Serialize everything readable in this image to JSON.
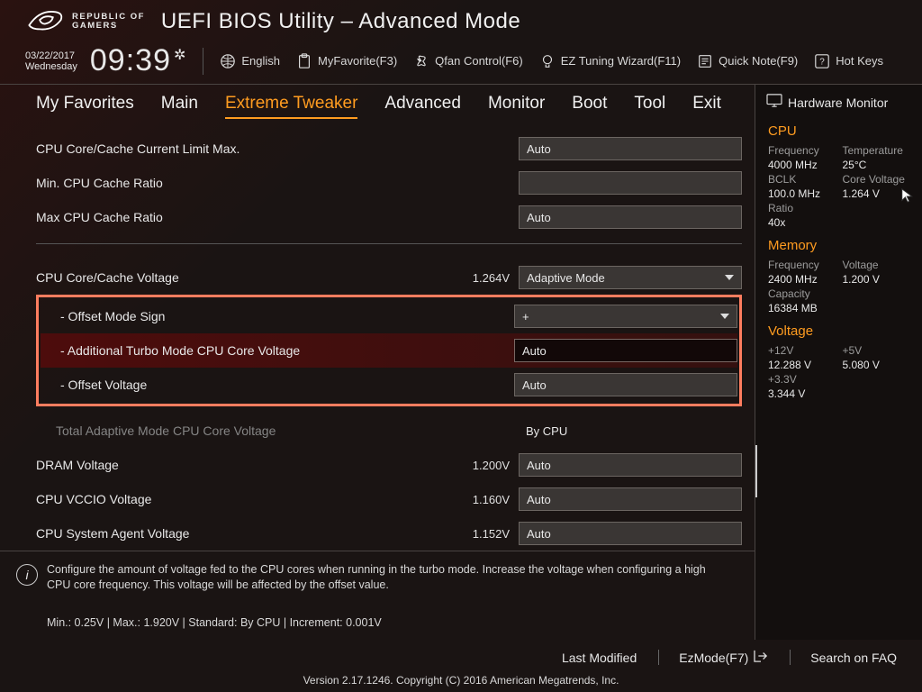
{
  "brand": {
    "line1": "REPUBLIC OF",
    "line2": "GAMERS"
  },
  "title": "UEFI BIOS Utility – Advanced Mode",
  "date": {
    "d": "03/22/2017",
    "w": "Wednesday"
  },
  "clock": "09:39",
  "toolbar": {
    "language": "English",
    "favorite": "MyFavorite(F3)",
    "qfan": "Qfan Control(F6)",
    "eztune": "EZ Tuning Wizard(F11)",
    "quicknote": "Quick Note(F9)",
    "hotkeys": "Hot Keys"
  },
  "tabs": [
    "My Favorites",
    "Main",
    "Extreme Tweaker",
    "Advanced",
    "Monitor",
    "Boot",
    "Tool",
    "Exit"
  ],
  "active_tab": 2,
  "hw_title": "Hardware Monitor",
  "settings": {
    "cpu_core_cache_limit": {
      "label": "CPU Core/Cache Current Limit Max.",
      "value": "Auto"
    },
    "min_cache_ratio": {
      "label": "Min. CPU Cache Ratio",
      "value": ""
    },
    "max_cache_ratio": {
      "label": "Max CPU Cache Ratio",
      "value": "Auto"
    },
    "cpu_core_cache_voltage": {
      "label": "CPU Core/Cache Voltage",
      "suffix": "1.264V",
      "value": "Adaptive Mode"
    },
    "offset_mode_sign": {
      "label": "- Offset Mode Sign",
      "value": "+"
    },
    "add_turbo_core_voltage": {
      "label": "- Additional Turbo Mode CPU Core Voltage",
      "value": "Auto"
    },
    "offset_voltage": {
      "label": "- Offset Voltage",
      "value": "Auto"
    },
    "total_adaptive": {
      "label": "Total Adaptive Mode CPU Core Voltage",
      "value": "By CPU"
    },
    "dram_voltage": {
      "label": "DRAM Voltage",
      "suffix": "1.200V",
      "value": "Auto"
    },
    "cpu_vccio": {
      "label": "CPU VCCIO Voltage",
      "suffix": "1.160V",
      "value": "Auto"
    },
    "cpu_sa": {
      "label": "CPU System Agent Voltage",
      "suffix": "1.152V",
      "value": "Auto"
    }
  },
  "help": {
    "text": "Configure the amount of voltage fed to the CPU cores when running in the turbo mode. Increase the voltage when configuring a high CPU core frequency. This voltage will be affected by the offset value.",
    "footer": "Min.: 0.25V   |   Max.: 1.920V   |   Standard: By CPU   |   Increment: 0.001V"
  },
  "hw": {
    "cpu": {
      "title": "CPU",
      "freq_l": "Frequency",
      "freq_v": "4000 MHz",
      "temp_l": "Temperature",
      "temp_v": "25°C",
      "bclk_l": "BCLK",
      "bclk_v": "100.0 MHz",
      "cv_l": "Core Voltage",
      "cv_v": "1.264 V",
      "ratio_l": "Ratio",
      "ratio_v": "40x"
    },
    "mem": {
      "title": "Memory",
      "freq_l": "Frequency",
      "freq_v": "2400 MHz",
      "volt_l": "Voltage",
      "volt_v": "1.200 V",
      "cap_l": "Capacity",
      "cap_v": "16384 MB"
    },
    "volt": {
      "title": "Voltage",
      "v12_l": "+12V",
      "v12_v": "12.288 V",
      "v5_l": "+5V",
      "v5_v": "5.080 V",
      "v33_l": "+3.3V",
      "v33_v": "3.344 V"
    }
  },
  "bottom": {
    "last_mod": "Last Modified",
    "ezmode": "EzMode(F7)",
    "search": "Search on FAQ"
  },
  "version": "Version 2.17.1246. Copyright (C) 2016 American Megatrends, Inc."
}
